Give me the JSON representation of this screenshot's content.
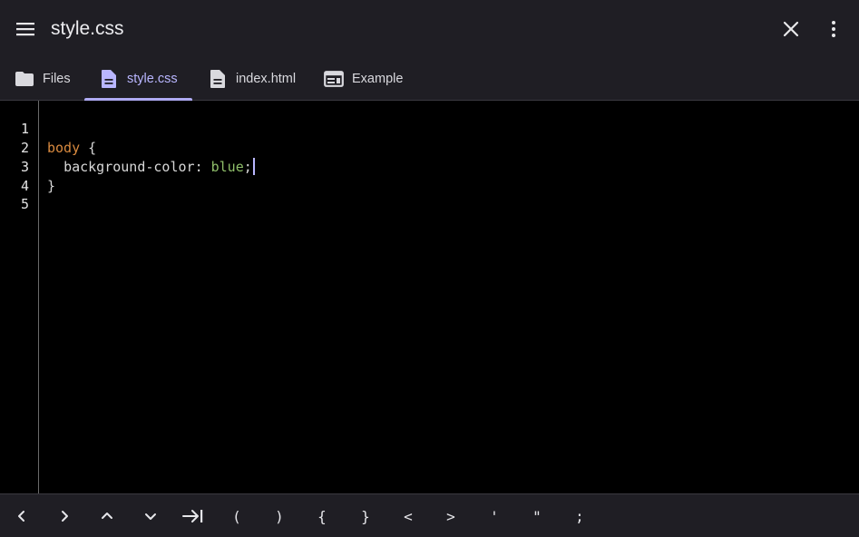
{
  "appbar": {
    "title": "style.css"
  },
  "tabs": [
    {
      "label": "Files",
      "icon": "folder-icon"
    },
    {
      "label": "style.css",
      "icon": "document-icon",
      "active": true
    },
    {
      "label": "index.html",
      "icon": "document-icon"
    },
    {
      "label": "Example",
      "icon": "preview-icon"
    }
  ],
  "editor": {
    "line_numbers": [
      "1",
      "2",
      "3",
      "4",
      "5"
    ],
    "lines": [
      {
        "selector": "",
        "rest": ""
      },
      {
        "selector": "body",
        "rest": " {"
      },
      {
        "indent": "  ",
        "property": "background-color",
        "colon": ": ",
        "value": "blue",
        "semicolon": ";"
      },
      {
        "selector": "",
        "rest": "}"
      },
      {
        "selector": "",
        "rest": ""
      }
    ]
  },
  "keybar": {
    "keys": [
      "<",
      ">",
      "^",
      "v",
      "tab",
      "(",
      ")",
      "{",
      "}",
      "<",
      ">",
      "'",
      "\"",
      ";"
    ]
  },
  "colors": {
    "accent": "#aeaaf2",
    "selector": "#d98a3f",
    "value": "#8fbf6a",
    "background": "#000000",
    "bar": "#1f1e24"
  }
}
